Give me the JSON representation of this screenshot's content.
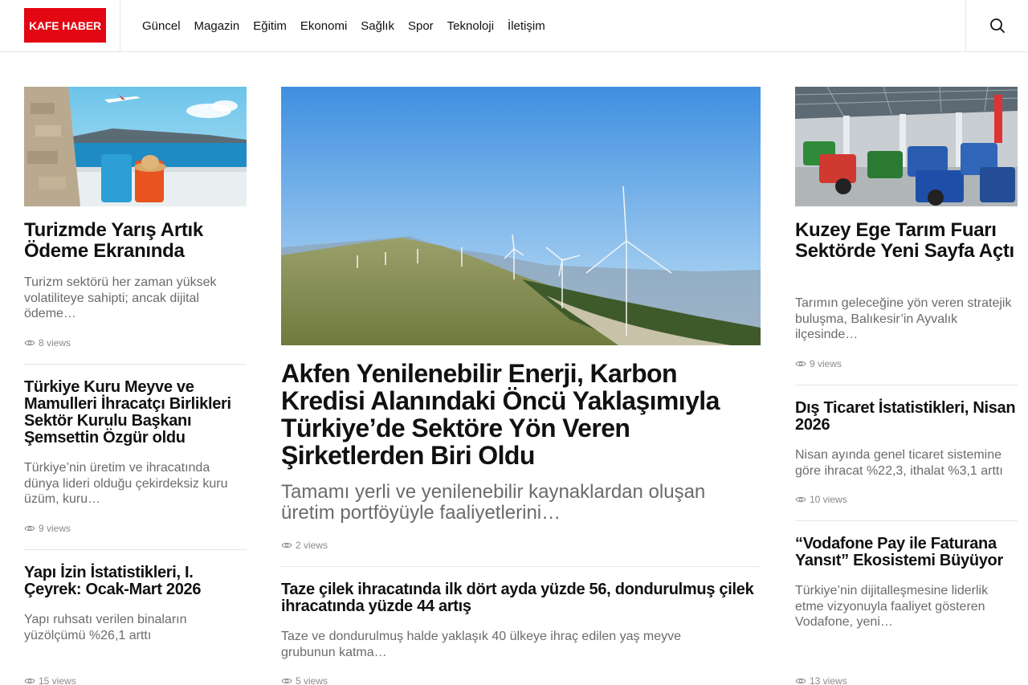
{
  "site": {
    "logo": "KAFE HABER",
    "nav": [
      "Güncel",
      "Magazin",
      "Eğitim",
      "Ekonomi",
      "Sağlık",
      "Spor",
      "Teknoloji",
      "İletişim"
    ],
    "accent": "#e30613"
  },
  "left": [
    {
      "title": "Turizmde Yarış Artık Ödeme Ekranında",
      "excerpt": "Turizm sektörü her zaman yüksek volatiliteye sahipti; ancak dijital ödeme…",
      "views": "8 views"
    },
    {
      "title": "Türkiye Kuru Meyve ve Mamulleri İhracatçı Birlikleri Sektör Kurulu Başkanı Şemsettin Özgür oldu",
      "excerpt": "Türkiye’nin üretim ve ihracatında dünya lideri olduğu çekirdeksiz kuru üzüm, kuru…",
      "views": "9 views"
    },
    {
      "title": "Yapı İzin İstatistikleri, I. Çeyrek: Ocak-Mart 2026",
      "excerpt": "Yapı ruhsatı verilen binaların yüzölçümü %26,1 arttı",
      "views": "15 views"
    }
  ],
  "featured": {
    "title": "Akfen Yenilenebilir Enerji, Karbon Kredisi Alanındaki Öncü Yaklaşımıyla Türkiye’de Sektöre Yön Veren Şirketlerden Biri Oldu",
    "excerpt": "Tamamı yerli ve yenilenebilir kaynaklardan oluşan üretim portföyüyle faaliyetlerini…",
    "views": "2 views"
  },
  "mid_second": {
    "title": "Taze çilek ihracatında ilk dört ayda yüzde 56, dondurulmuş çilek ihracatında yüzde 44 artış",
    "excerpt": "Taze ve dondurulmuş halde yaklaşık 40 ülkeye ihraç edilen yaş meyve grubunun katma…",
    "views": "5 views"
  },
  "right": [
    {
      "title": "Kuzey Ege Tarım Fuarı Sektörde Yeni Sayfa Açtı",
      "excerpt": "Tarımın geleceğine yön veren stratejik buluşma, Balıkesir’in Ayvalık ilçesinde…",
      "views": "9 views"
    },
    {
      "title": "Dış Ticaret İstatistikleri, Nisan 2026",
      "excerpt": "Nisan ayında genel ticaret sistemine göre ihracat %22,3, ithalat %3,1 arttı",
      "views": "10 views"
    },
    {
      "title": "“Vodafone Pay ile Faturana Yansıt” Ekosistemi Büyüyor",
      "excerpt": "Türkiye’nin dijitalleşmesine liderlik etme vizyonuyla faaliyet gösteren Vodafone, yeni…",
      "views": "13 views"
    }
  ]
}
